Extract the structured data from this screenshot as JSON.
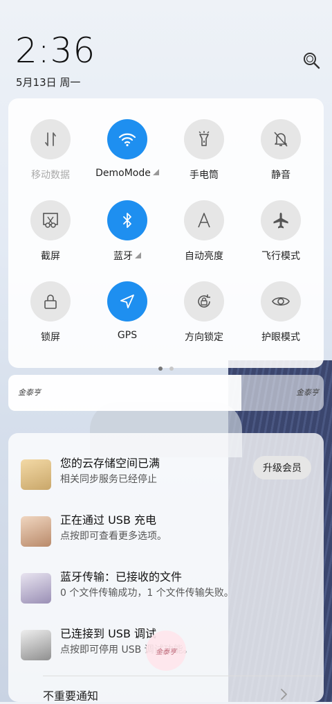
{
  "status": {
    "time": "2:36",
    "date": "5月13日 周一"
  },
  "tiles": [
    {
      "label": "移动数据",
      "icon": "mobile-data-icon",
      "active": false,
      "dim": true
    },
    {
      "label": "DemoMode",
      "icon": "wifi-icon",
      "active": true,
      "expand": true
    },
    {
      "label": "手电筒",
      "icon": "flashlight-icon",
      "active": false
    },
    {
      "label": "静音",
      "icon": "mute-bell-icon",
      "active": false
    },
    {
      "label": "截屏",
      "icon": "screenshot-icon",
      "active": false
    },
    {
      "label": "蓝牙",
      "icon": "bluetooth-icon",
      "active": true,
      "expand": true
    },
    {
      "label": "自动亮度",
      "icon": "auto-brightness-icon",
      "active": false
    },
    {
      "label": "飞行模式",
      "icon": "airplane-icon",
      "active": false
    },
    {
      "label": "锁屏",
      "icon": "lock-icon",
      "active": false
    },
    {
      "label": "GPS",
      "icon": "gps-icon",
      "active": true
    },
    {
      "label": "方向锁定",
      "icon": "rotation-lock-icon",
      "active": false
    },
    {
      "label": "护眼模式",
      "icon": "eye-icon",
      "active": false
    }
  ],
  "brightness": {
    "level": 0.74,
    "signature_left": "金泰亨",
    "signature_right": "金泰亨"
  },
  "notifications": [
    {
      "title": "您的云存储空间已满",
      "text": "相关同步服务已经停止",
      "action": "升级会员"
    },
    {
      "title": "正在通过 USB 充电",
      "text": "点按即可查看更多选项。"
    },
    {
      "title": "蓝牙传输：已接收的文件",
      "text": "0 个文件传输成功，1 个文件传输失败。"
    },
    {
      "title": "已连接到 USB 调试",
      "text": "点按即可停用 USB 调试功能。"
    }
  ],
  "minor_notifications": "不重要通知",
  "floating_signature": "金泰亨",
  "colors": {
    "accent": "#1e8ff0"
  }
}
